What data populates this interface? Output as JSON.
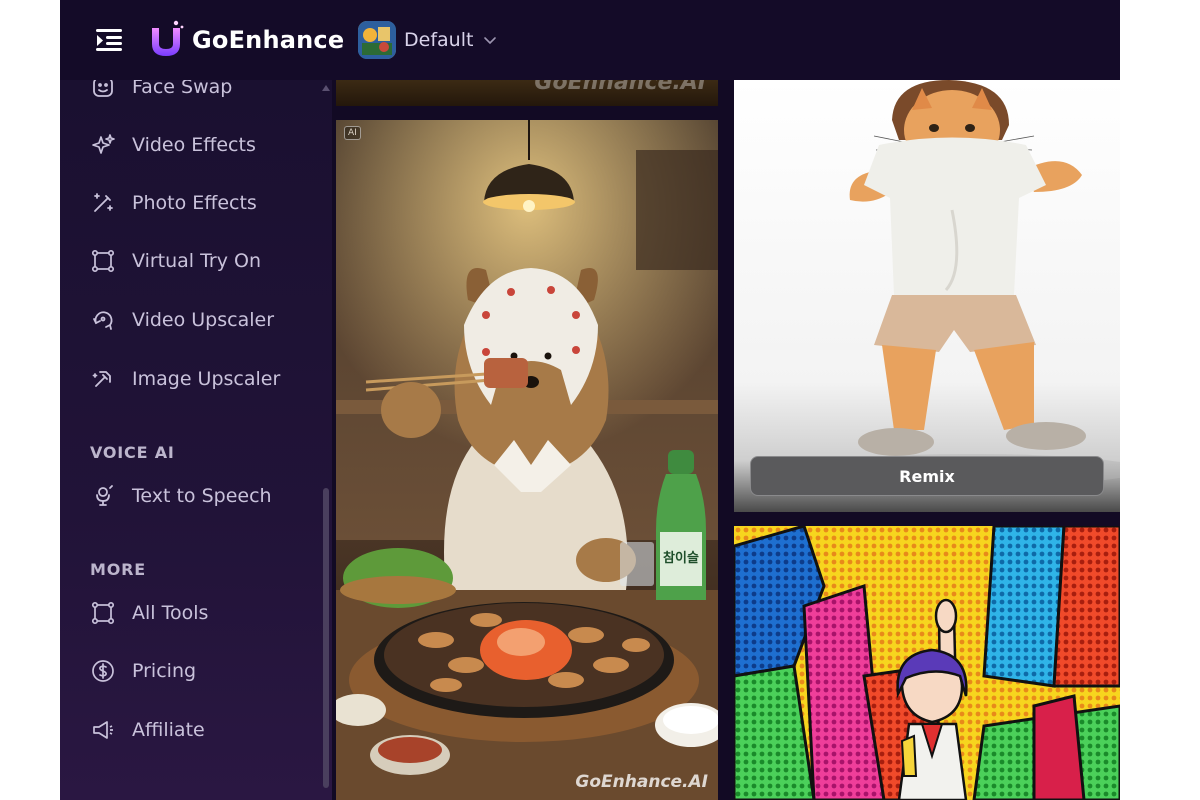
{
  "app": {
    "brand_name": "GoEnhance",
    "workspace_name": "Default"
  },
  "sidebar": {
    "items": [
      {
        "label": "Face Swap",
        "icon": "face-swap-icon"
      },
      {
        "label": "Video Effects",
        "icon": "sparkles-icon"
      },
      {
        "label": "Photo Effects",
        "icon": "magic-wand-icon"
      },
      {
        "label": "Virtual Try On",
        "icon": "bounding-box-icon"
      },
      {
        "label": "Video Upscaler",
        "icon": "upscale-icon"
      },
      {
        "label": "Image Upscaler",
        "icon": "image-upscale-icon"
      }
    ],
    "voice_section_title": "VOICE AI",
    "voice_items": [
      {
        "label": "Text to Speech",
        "icon": "microphone-icon"
      }
    ],
    "more_section_title": "MORE",
    "more_items": [
      {
        "label": "All Tools",
        "icon": "bounding-box-icon"
      },
      {
        "label": "Pricing",
        "icon": "dollar-icon"
      },
      {
        "label": "Affiliate",
        "icon": "megaphone-icon"
      }
    ]
  },
  "gallery": {
    "top_strip_watermark": "GoEnhance.AI",
    "dog_card": {
      "badge": "AI",
      "watermark": "GoEnhance.AI",
      "bottle_label": "참이슬"
    },
    "cat_card": {
      "remix_label": "Remix"
    }
  },
  "colors": {
    "background": "#120a24",
    "sidebar_text": "#c9c2db",
    "accent_gradient_start": "#e06cff",
    "accent_gradient_end": "#6a3cff"
  }
}
